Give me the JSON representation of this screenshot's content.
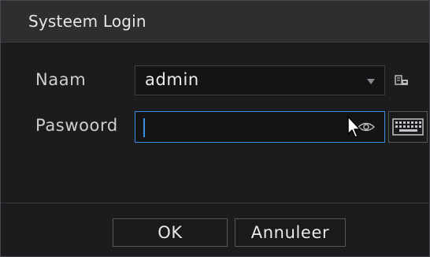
{
  "dialog": {
    "title": "Systeem Login"
  },
  "form": {
    "username_label": "Naam",
    "username_value": "admin",
    "password_label": "Paswoord",
    "password_value": ""
  },
  "buttons": {
    "ok_label": "OK",
    "cancel_label": "Annuleer"
  },
  "icons": {
    "username_dropdown": "chevron-down-icon",
    "user_picker": "user-list-icon",
    "show_password": "eye-icon",
    "virtual_keyboard": "keyboard-icon",
    "mouse_pointer": "cursor-icon"
  },
  "colors": {
    "focus_border": "#3b8ee6",
    "background": "#1c1c1e",
    "titlebar": "#2e2e31"
  }
}
